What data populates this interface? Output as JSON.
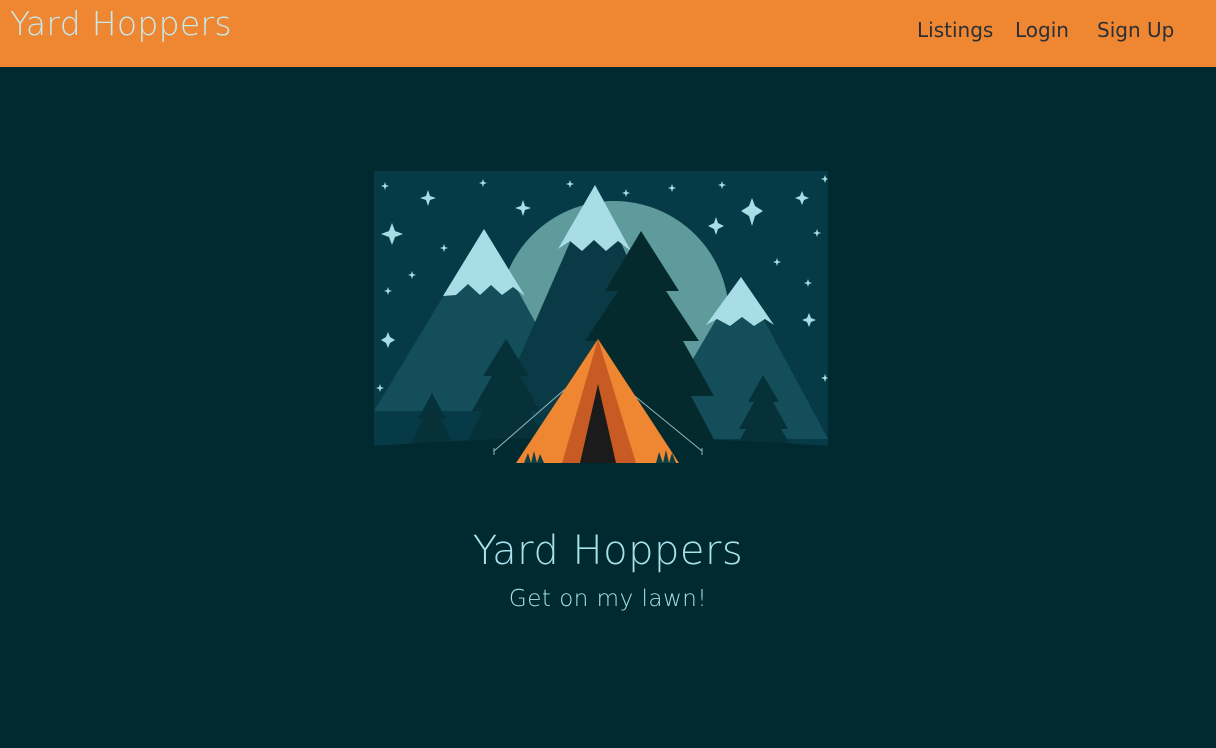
{
  "navbar": {
    "brand": "Yard Hoppers",
    "links": [
      "Listings",
      "Login",
      "Sign Up"
    ]
  },
  "hero": {
    "image_icon": "camping-tent-mountains-illustration",
    "title": "Yard Hoppers",
    "tagline": "Get on my lawn!"
  },
  "colors": {
    "navbar_bg": "#ef8632",
    "page_bg": "#002a2f",
    "brand_text": "#c3ecee",
    "nav_link_text": "#2a3035",
    "hero_text": "#a8e2ec",
    "sky": "#073a47",
    "moon": "#5f9a9c",
    "snow": "#a8dde6",
    "tent": "#ef8632"
  }
}
